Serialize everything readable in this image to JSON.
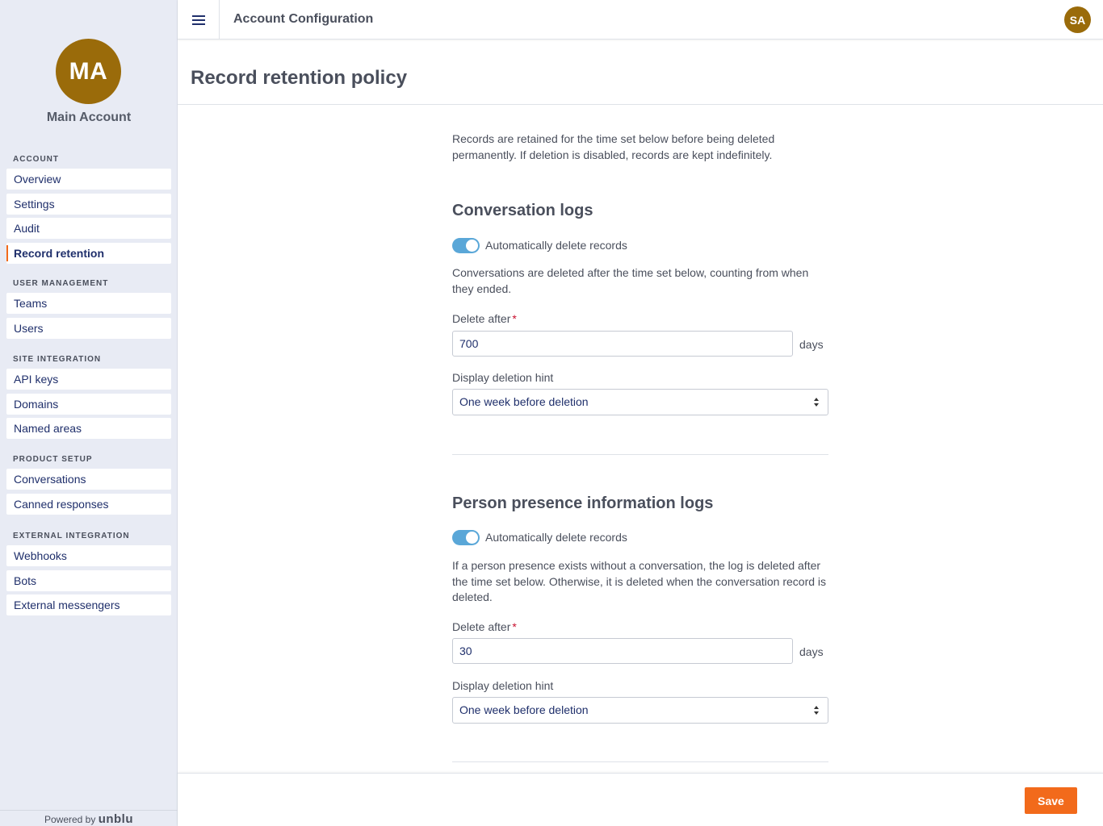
{
  "sidebar": {
    "avatar_initials": "MA",
    "account_name": "Main Account",
    "sections": [
      {
        "heading": "ACCOUNT",
        "items": [
          "Overview",
          "Settings",
          "Audit",
          "Record retention"
        ]
      },
      {
        "heading": "USER MANAGEMENT",
        "items": [
          "Teams",
          "Users"
        ]
      },
      {
        "heading": "SITE INTEGRATION",
        "items": [
          "API keys",
          "Domains",
          "Named areas"
        ]
      },
      {
        "heading": "PRODUCT SETUP",
        "items": [
          "Conversations",
          "Canned responses"
        ]
      },
      {
        "heading": "EXTERNAL INTEGRATION",
        "items": [
          "Webhooks",
          "Bots",
          "External messengers"
        ]
      }
    ],
    "active_item": "Record retention",
    "powered_by": "Powered by",
    "brand": "unblu"
  },
  "topbar": {
    "menu_icon": "hamburger-menu-icon",
    "title": "Account Configuration",
    "user_initials": "SA"
  },
  "page": {
    "title": "Record retention policy",
    "intro": "Records are retained for the time set below before being deleted permanently. If deletion is disabled, records are kept indefinitely."
  },
  "conversation_logs": {
    "title": "Conversation logs",
    "toggle_label": "Automatically delete records",
    "toggle_on": true,
    "description": "Conversations are deleted after the time set below, counting from when they ended.",
    "delete_after_label": "Delete after",
    "required_mark": "*",
    "delete_after_value": "700",
    "unit": "days",
    "hint_label": "Display deletion hint",
    "hint_value": "One week before deletion"
  },
  "presence_logs": {
    "title": "Person presence information logs",
    "toggle_label": "Automatically delete records",
    "toggle_on": true,
    "description": "If a person presence exists without a conversation, the log is deleted after the time set below. Otherwise, it is deleted when the conversation record is deleted.",
    "delete_after_label": "Delete after",
    "required_mark": "*",
    "delete_after_value": "30",
    "unit": "days",
    "hint_label": "Display deletion hint",
    "hint_value": "One week before deletion"
  },
  "footer": {
    "save_label": "Save"
  },
  "colors": {
    "accent": "#f26a1b",
    "avatar": "#9a6b0a",
    "toggle_on": "#5aa7d8",
    "link": "#1f2f6b",
    "sidebar_bg": "#e8ebf4"
  }
}
